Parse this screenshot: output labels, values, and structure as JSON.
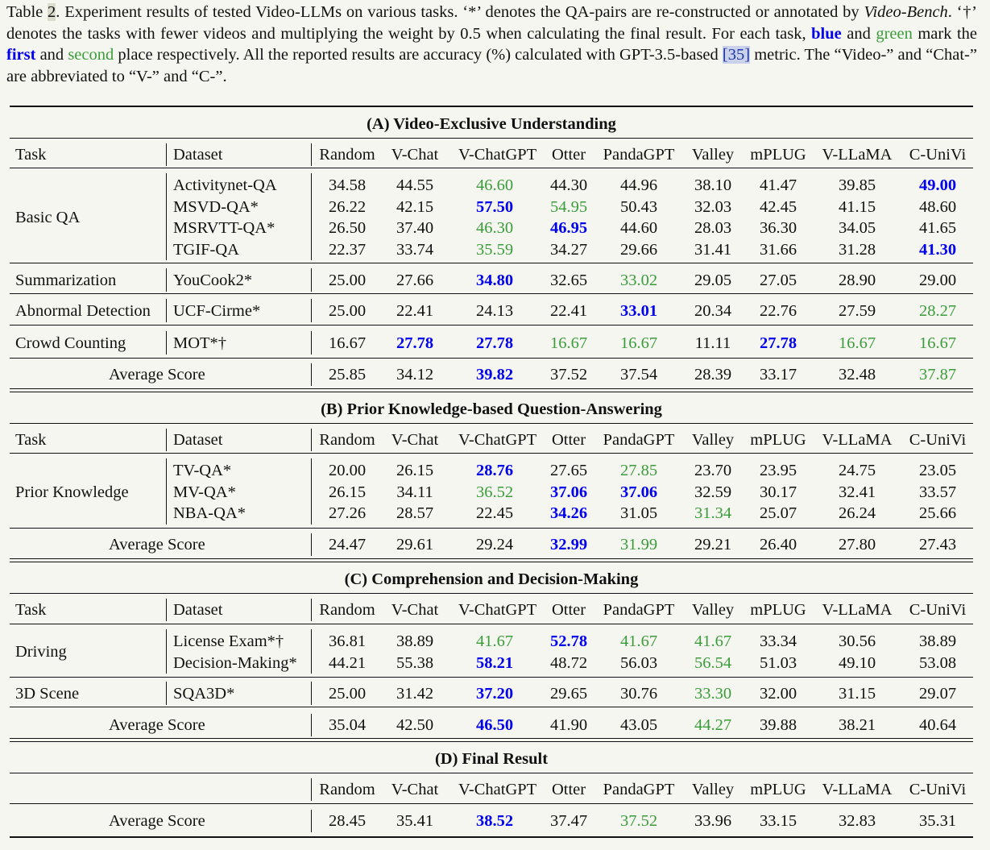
{
  "caption": {
    "table_label": "Table",
    "table_num": "2",
    "p1": ". Experiment results of tested Video-LLMs on various tasks. ‘*’ denotes the QA-pairs are re-constructed or annotated by ",
    "p1_italic": "Video-Bench",
    "p2": ". ‘†’ denotes the tasks with fewer videos and multiplying the weight by 0.5 when calculating the final result. For each task, ",
    "blue_word": "blue",
    "and1": " and ",
    "green_word": "green",
    "p3": " mark the ",
    "first_word": "first",
    "and2": " and ",
    "second_word": "second",
    "p4": " place respectively. All the reported results are accuracy (%) calculated with GPT-3.5-based ",
    "ref": "[35]",
    "p5": " metric. The “Video-” and “Chat-” are abbreviated to “V-” and “C-”."
  },
  "table": {
    "header": {
      "task": "Task",
      "dataset": "Dataset",
      "models": [
        "Random",
        "V-Chat",
        "V-ChatGPT",
        "Otter",
        "PandaGPT",
        "Valley",
        "mPLUG",
        "V-LLaMA",
        "C-UniVi"
      ]
    },
    "sections": [
      {
        "title": "(A) Video-Exclusive Understanding",
        "groups": [
          {
            "task": "Basic QA",
            "rows": [
              {
                "dataset": "Activitynet-QA",
                "values": [
                  "34.58",
                  "44.55",
                  "46.60",
                  "44.30",
                  "44.96",
                  "38.10",
                  "41.47",
                  "39.85",
                  "49.00"
                ],
                "marks": [
                  "",
                  "",
                  "g",
                  "",
                  "",
                  "",
                  "",
                  "",
                  "b"
                ]
              },
              {
                "dataset": "MSVD-QA*",
                "values": [
                  "26.22",
                  "42.15",
                  "57.50",
                  "54.95",
                  "50.43",
                  "32.03",
                  "42.45",
                  "41.15",
                  "48.60"
                ],
                "marks": [
                  "",
                  "",
                  "b",
                  "g",
                  "",
                  "",
                  "",
                  "",
                  ""
                ]
              },
              {
                "dataset": "MSRVTT-QA*",
                "values": [
                  "26.50",
                  "37.40",
                  "46.30",
                  "46.95",
                  "44.60",
                  "28.03",
                  "36.30",
                  "34.05",
                  "41.65"
                ],
                "marks": [
                  "",
                  "",
                  "g",
                  "b",
                  "",
                  "",
                  "",
                  "",
                  ""
                ]
              },
              {
                "dataset": "TGIF-QA",
                "values": [
                  "22.37",
                  "33.74",
                  "35.59",
                  "34.27",
                  "29.66",
                  "31.41",
                  "31.66",
                  "31.28",
                  "41.30"
                ],
                "marks": [
                  "",
                  "",
                  "g",
                  "",
                  "",
                  "",
                  "",
                  "",
                  "b"
                ]
              }
            ]
          },
          {
            "task": "Summarization",
            "rows": [
              {
                "dataset": "YouCook2*",
                "values": [
                  "25.00",
                  "27.66",
                  "34.80",
                  "32.65",
                  "33.02",
                  "29.05",
                  "27.05",
                  "28.90",
                  "29.00"
                ],
                "marks": [
                  "",
                  "",
                  "b",
                  "",
                  "g",
                  "",
                  "",
                  "",
                  ""
                ]
              }
            ]
          },
          {
            "task": "Abnormal Detection",
            "rows": [
              {
                "dataset": "UCF-Cirme*",
                "values": [
                  "25.00",
                  "22.41",
                  "24.13",
                  "22.41",
                  "33.01",
                  "20.34",
                  "22.76",
                  "27.59",
                  "28.27"
                ],
                "marks": [
                  "",
                  "",
                  "",
                  "",
                  "b",
                  "",
                  "",
                  "",
                  "g"
                ]
              }
            ]
          },
          {
            "task": "Crowd Counting",
            "rows": [
              {
                "dataset": "MOT*†",
                "values": [
                  "16.67",
                  "27.78",
                  "27.78",
                  "16.67",
                  "16.67",
                  "11.11",
                  "27.78",
                  "16.67",
                  "16.67"
                ],
                "marks": [
                  "",
                  "b",
                  "b",
                  "g",
                  "g",
                  "",
                  "b",
                  "g",
                  "g"
                ]
              }
            ]
          }
        ],
        "average": {
          "label": "Average Score",
          "values": [
            "25.85",
            "34.12",
            "39.82",
            "37.52",
            "37.54",
            "28.39",
            "33.17",
            "32.48",
            "37.87"
          ],
          "marks": [
            "",
            "",
            "b",
            "",
            "",
            "",
            "",
            "",
            "g"
          ]
        }
      },
      {
        "title": "(B) Prior Knowledge-based Question-Answering",
        "groups": [
          {
            "task": "Prior Knowledge",
            "rows": [
              {
                "dataset": "TV-QA*",
                "values": [
                  "20.00",
                  "26.15",
                  "28.76",
                  "27.65",
                  "27.85",
                  "23.70",
                  "23.95",
                  "24.75",
                  "23.05"
                ],
                "marks": [
                  "",
                  "",
                  "b",
                  "",
                  "g",
                  "",
                  "",
                  "",
                  ""
                ]
              },
              {
                "dataset": "MV-QA*",
                "values": [
                  "26.15",
                  "34.11",
                  "36.52",
                  "37.06",
                  "37.06",
                  "32.59",
                  "30.17",
                  "32.41",
                  "33.57"
                ],
                "marks": [
                  "",
                  "",
                  "g",
                  "b",
                  "b",
                  "",
                  "",
                  "",
                  ""
                ]
              },
              {
                "dataset": "NBA-QA*",
                "values": [
                  "27.26",
                  "28.57",
                  "22.45",
                  "34.26",
                  "31.05",
                  "31.34",
                  "25.07",
                  "26.24",
                  "25.66"
                ],
                "marks": [
                  "",
                  "",
                  "",
                  "b",
                  "",
                  "g",
                  "",
                  "",
                  ""
                ]
              }
            ]
          }
        ],
        "average": {
          "label": "Average Score",
          "values": [
            "24.47",
            "29.61",
            "29.24",
            "32.99",
            "31.99",
            "29.21",
            "26.40",
            "27.80",
            "27.43"
          ],
          "marks": [
            "",
            "",
            "",
            "b",
            "g",
            "",
            "",
            "",
            ""
          ]
        }
      },
      {
        "title": "(C) Comprehension and Decision-Making",
        "groups": [
          {
            "task": "Driving",
            "rows": [
              {
                "dataset": "License Exam*†",
                "values": [
                  "36.81",
                  "38.89",
                  "41.67",
                  "52.78",
                  "41.67",
                  "41.67",
                  "33.34",
                  "30.56",
                  "38.89"
                ],
                "marks": [
                  "",
                  "",
                  "g",
                  "b",
                  "g",
                  "g",
                  "",
                  "",
                  ""
                ]
              },
              {
                "dataset": "Decision-Making*",
                "values": [
                  "44.21",
                  "55.38",
                  "58.21",
                  "48.72",
                  "56.03",
                  "56.54",
                  "51.03",
                  "49.10",
                  "53.08"
                ],
                "marks": [
                  "",
                  "",
                  "b",
                  "",
                  "",
                  "g",
                  "",
                  "",
                  ""
                ]
              }
            ]
          },
          {
            "task": "3D Scene",
            "rows": [
              {
                "dataset": "SQA3D*",
                "values": [
                  "25.00",
                  "31.42",
                  "37.20",
                  "29.65",
                  "30.76",
                  "33.30",
                  "32.00",
                  "31.15",
                  "29.07"
                ],
                "marks": [
                  "",
                  "",
                  "b",
                  "",
                  "",
                  "g",
                  "",
                  "",
                  ""
                ]
              }
            ]
          }
        ],
        "average": {
          "label": "Average Score",
          "values": [
            "35.04",
            "42.50",
            "46.50",
            "41.90",
            "43.05",
            "44.27",
            "39.88",
            "38.21",
            "40.64"
          ],
          "marks": [
            "",
            "",
            "b",
            "",
            "",
            "g",
            "",
            "",
            ""
          ]
        }
      },
      {
        "title": "(D) Final Result",
        "groups": [],
        "average": {
          "label": "Average Score",
          "values": [
            "28.45",
            "35.41",
            "38.52",
            "37.47",
            "37.52",
            "33.96",
            "33.15",
            "32.83",
            "35.31"
          ],
          "marks": [
            "",
            "",
            "b",
            "",
            "g",
            "",
            "",
            "",
            ""
          ]
        }
      }
    ]
  }
}
